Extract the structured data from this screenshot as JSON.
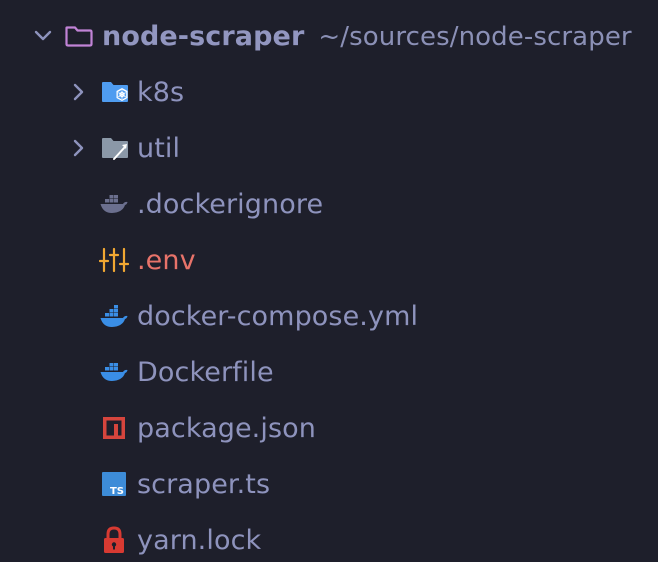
{
  "explorer": {
    "root": {
      "name": "node-scraper",
      "path": "~/sources/node-scraper",
      "expanded": true,
      "icon": "folder-icon"
    },
    "items": [
      {
        "name": "k8s",
        "type": "folder",
        "expanded": false,
        "icon": "kubernetes-folder-icon"
      },
      {
        "name": "util",
        "type": "folder",
        "expanded": false,
        "icon": "tools-folder-icon"
      },
      {
        "name": ".dockerignore",
        "type": "file",
        "icon": "docker-ignore-icon"
      },
      {
        "name": ".env",
        "type": "file",
        "icon": "tune-icon"
      },
      {
        "name": "docker-compose.yml",
        "type": "file",
        "icon": "docker-icon"
      },
      {
        "name": "Dockerfile",
        "type": "file",
        "icon": "docker-icon"
      },
      {
        "name": "package.json",
        "type": "file",
        "icon": "npm-icon"
      },
      {
        "name": "scraper.ts",
        "type": "file",
        "icon": "typescript-icon"
      },
      {
        "name": "yarn.lock",
        "type": "file",
        "icon": "lock-icon"
      }
    ]
  },
  "colors": {
    "background": "#1e1f2b",
    "text": "#8e93bd",
    "env_text": "#e8736a",
    "folder_outline": "#c183d6",
    "k8s_blue": "#4f9cf0",
    "util_gray": "#8b98a8",
    "docker_blue": "#3a8ee6",
    "docker_ignore": "#6b6f8e",
    "env_orange": "#f0a732",
    "npm_red": "#d6453d",
    "ts_blue": "#3d8cd8",
    "lock_red": "#d83a32"
  }
}
